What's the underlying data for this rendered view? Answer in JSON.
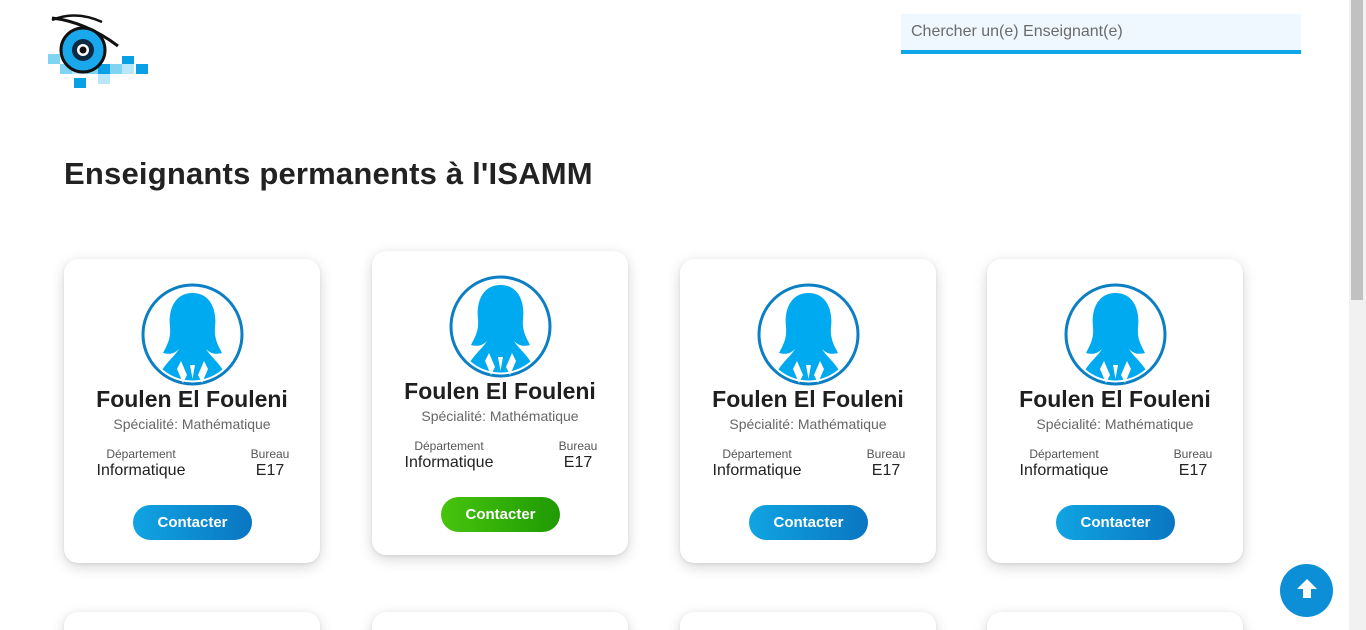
{
  "header": {
    "logo": "isamm-eye-logo",
    "search": {
      "placeholder": "Chercher un(e) Enseignant(e)",
      "value": ""
    }
  },
  "main": {
    "title": "Enseignants permanents à l'ISAMM",
    "cards": [
      {
        "name": "Foulen El Fouleni",
        "specialty": "Spécialité: Mathématique",
        "dept_label": "Département",
        "dept_value": "Informatique",
        "office_label": "Bureau",
        "office_value": "E17",
        "button": "Contacter",
        "state": "normal"
      },
      {
        "name": "Foulen El Fouleni",
        "specialty": "Spécialité: Mathématique",
        "dept_label": "Département",
        "dept_value": "Informatique",
        "office_label": "Bureau",
        "office_value": "E17",
        "button": "Contacter",
        "state": "hover"
      },
      {
        "name": "Foulen El Fouleni",
        "specialty": "Spécialité: Mathématique",
        "dept_label": "Département",
        "dept_value": "Informatique",
        "office_label": "Bureau",
        "office_value": "E17",
        "button": "Contacter",
        "state": "normal"
      },
      {
        "name": "Foulen El Fouleni",
        "specialty": "Spécialité: Mathématique",
        "dept_label": "Département",
        "dept_value": "Informatique",
        "office_label": "Bureau",
        "office_value": "E17",
        "button": "Contacter",
        "state": "normal"
      }
    ]
  },
  "colors": {
    "accent": "#0ea5e9",
    "button_blue": "#0a8ad3",
    "button_green": "#2eaa06",
    "avatar_blue": "#00aaf0"
  },
  "icons": {
    "scroll_top": "arrow-up-icon",
    "avatar": "female-avatar-icon"
  }
}
